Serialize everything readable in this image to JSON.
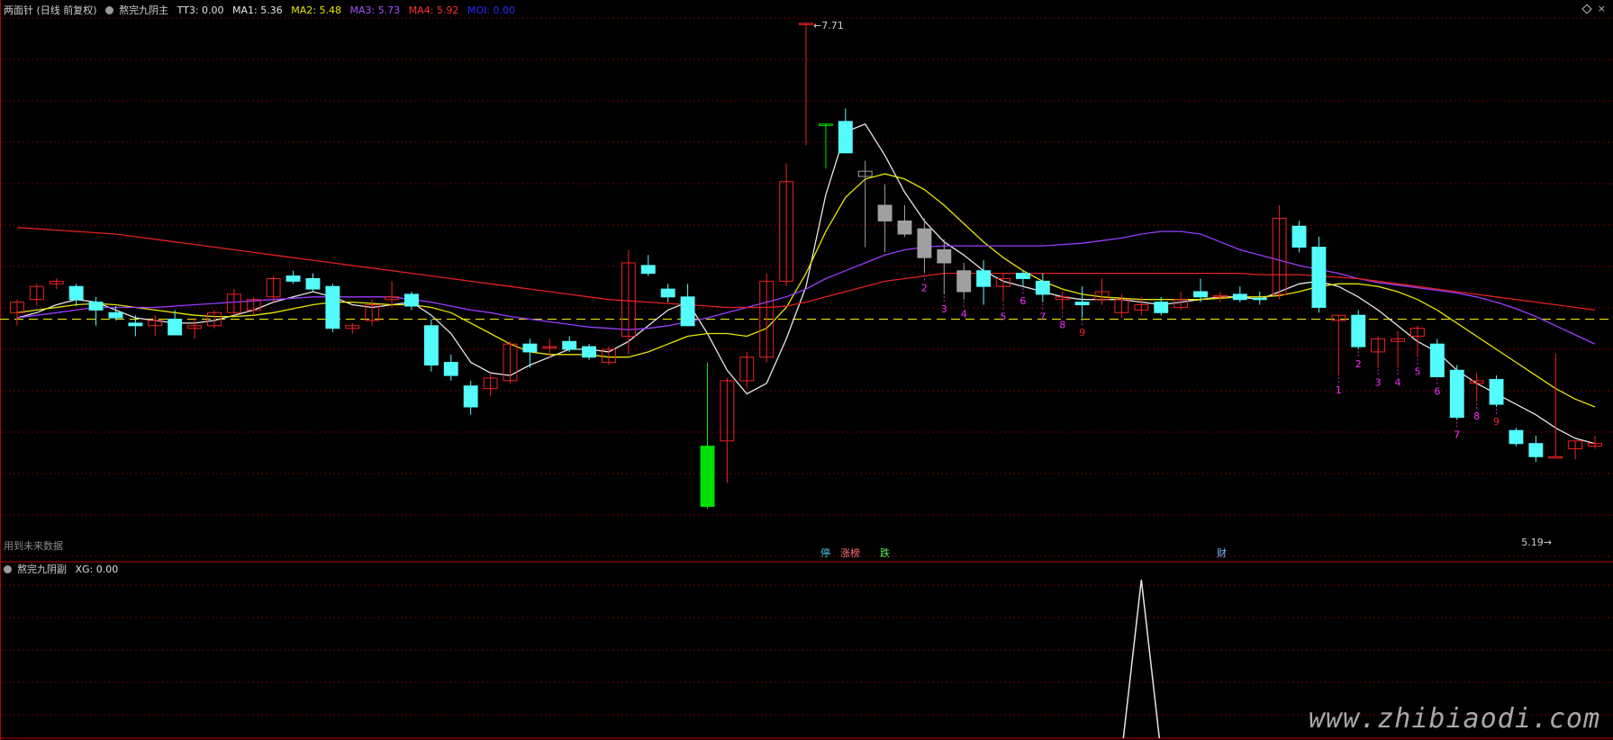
{
  "main_header": {
    "title": "两面针 (日线 前复权)",
    "indicator": "熬完九阴主",
    "tt3": "TT3: 0.00",
    "ma1": "MA1: 5.36",
    "ma2": "MA2: 5.48",
    "ma3": "MA3: 5.73",
    "ma4": "MA4: 5.92",
    "mo": "MOI: 0.00"
  },
  "sub_header": {
    "indicator": "熬完九阴副",
    "xg": "XG: 0.00"
  },
  "notes": {
    "future_data": "用到未来数据",
    "high_label": "7.71",
    "low_label": "5.19"
  },
  "tags": [
    {
      "text": "停",
      "color": "#44c6e6"
    },
    {
      "text": "涨榜",
      "color": "#ff7070"
    },
    {
      "text": "跌",
      "color": "#55ee55"
    },
    {
      "text": "财",
      "color": "#7fb6ff"
    }
  ],
  "watermark": "www.zhibiaodi.com",
  "colors": {
    "up": "#ee2222",
    "down": "#54fcfc",
    "limit_down": "#00e000",
    "ma1": "#e6e6e6",
    "ma2": "#e6e600",
    "ma3": "#9a3cff",
    "ma4": "#e02020",
    "grid": "#6a0000"
  },
  "icons": [
    "indicator-toggle-icon",
    "collapse-diamond-icon",
    "close-x-icon"
  ],
  "chart_data": {
    "type": "candlestick",
    "series_fields": [
      "open",
      "high",
      "low",
      "close"
    ],
    "candles": [
      [
        5.5,
        5.6,
        5.4,
        5.58
      ],
      [
        5.6,
        5.72,
        5.55,
        5.7
      ],
      [
        5.72,
        5.76,
        5.68,
        5.74
      ],
      [
        5.7,
        5.72,
        5.55,
        5.6
      ],
      [
        5.58,
        5.62,
        5.4,
        5.52
      ],
      [
        5.5,
        5.55,
        5.44,
        5.46
      ],
      [
        5.42,
        5.48,
        5.32,
        5.4
      ],
      [
        5.4,
        5.48,
        5.32,
        5.44
      ],
      [
        5.45,
        5.52,
        5.4,
        5.33
      ],
      [
        5.38,
        5.46,
        5.3,
        5.4
      ],
      [
        5.4,
        5.52,
        5.38,
        5.5
      ],
      [
        5.5,
        5.68,
        5.48,
        5.64
      ],
      [
        5.52,
        5.62,
        5.48,
        5.6
      ],
      [
        5.62,
        5.78,
        5.58,
        5.76
      ],
      [
        5.78,
        5.82,
        5.72,
        5.74
      ],
      [
        5.76,
        5.8,
        5.66,
        5.68
      ],
      [
        5.7,
        5.72,
        5.35,
        5.38
      ],
      [
        5.38,
        5.42,
        5.34,
        5.4
      ],
      [
        5.44,
        5.6,
        5.4,
        5.56
      ],
      [
        5.6,
        5.74,
        5.54,
        5.62
      ],
      [
        5.64,
        5.66,
        5.52,
        5.55
      ],
      [
        5.4,
        5.45,
        5.05,
        5.1
      ],
      [
        5.12,
        5.18,
        4.98,
        5.02
      ],
      [
        4.94,
        4.98,
        4.72,
        4.78
      ],
      [
        4.92,
        5.04,
        4.86,
        5.0
      ],
      [
        4.98,
        5.28,
        4.96,
        5.26
      ],
      [
        5.26,
        5.3,
        5.08,
        5.2
      ],
      [
        5.24,
        5.3,
        5.16,
        5.24
      ],
      [
        5.28,
        5.32,
        5.2,
        5.22
      ],
      [
        5.24,
        5.26,
        5.14,
        5.16
      ],
      [
        5.12,
        5.24,
        5.1,
        5.22
      ],
      [
        5.32,
        5.98,
        5.18,
        5.88
      ],
      [
        5.86,
        5.94,
        5.78,
        5.8
      ],
      [
        5.68,
        5.72,
        5.58,
        5.62
      ],
      [
        5.62,
        5.72,
        5.5,
        5.4
      ],
      [
        4.48,
        5.12,
        4.0,
        4.02
      ],
      [
        4.52,
        5.0,
        4.2,
        4.98
      ],
      [
        4.98,
        5.2,
        4.92,
        5.16
      ],
      [
        5.16,
        5.8,
        5.12,
        5.74
      ],
      [
        5.74,
        6.64,
        5.7,
        6.5
      ],
      [
        7.71,
        7.71,
        6.78,
        7.71
      ],
      [
        6.94,
        6.94,
        6.6,
        6.94
      ],
      [
        6.96,
        7.06,
        6.72,
        6.72
      ],
      [
        6.54,
        6.66,
        6.0,
        6.58
      ],
      [
        6.32,
        6.48,
        5.96,
        6.2
      ],
      [
        6.2,
        6.32,
        6.08,
        6.1
      ],
      [
        6.14,
        6.22,
        5.8,
        5.92
      ],
      [
        5.98,
        6.06,
        5.64,
        5.88
      ],
      [
        5.82,
        5.88,
        5.6,
        5.66
      ],
      [
        5.82,
        5.9,
        5.56,
        5.7
      ],
      [
        5.7,
        5.8,
        5.58,
        5.76
      ],
      [
        5.8,
        5.82,
        5.7,
        5.76
      ],
      [
        5.74,
        5.8,
        5.58,
        5.64
      ],
      [
        5.6,
        5.66,
        5.52,
        5.62
      ],
      [
        5.58,
        5.7,
        5.46,
        5.56
      ],
      [
        5.6,
        5.76,
        5.56,
        5.66
      ],
      [
        5.5,
        5.64,
        5.46,
        5.6
      ],
      [
        5.52,
        5.62,
        5.48,
        5.56
      ],
      [
        5.58,
        5.62,
        5.48,
        5.5
      ],
      [
        5.54,
        5.66,
        5.52,
        5.6
      ],
      [
        5.66,
        5.76,
        5.58,
        5.62
      ],
      [
        5.62,
        5.66,
        5.58,
        5.63
      ],
      [
        5.64,
        5.7,
        5.58,
        5.6
      ],
      [
        5.61,
        5.66,
        5.56,
        5.6
      ],
      [
        5.64,
        6.32,
        5.6,
        6.22
      ],
      [
        6.16,
        6.2,
        5.96,
        6.0
      ],
      [
        6.0,
        6.08,
        5.5,
        5.54
      ],
      [
        5.44,
        5.48,
        5.02,
        5.48
      ],
      [
        5.48,
        5.52,
        5.22,
        5.24
      ],
      [
        5.2,
        5.32,
        5.08,
        5.3
      ],
      [
        5.28,
        5.36,
        5.08,
        5.3
      ],
      [
        5.32,
        5.4,
        5.16,
        5.38
      ],
      [
        5.26,
        5.3,
        5.02,
        5.01
      ],
      [
        5.06,
        5.1,
        4.68,
        4.7
      ],
      [
        4.96,
        5.04,
        4.82,
        4.98
      ],
      [
        4.99,
        5.02,
        4.78,
        4.8
      ],
      [
        4.6,
        4.62,
        4.48,
        4.5
      ],
      [
        4.5,
        4.56,
        4.36,
        4.4
      ],
      [
        4.4,
        4.4,
        5.19,
        4.4
      ],
      [
        4.46,
        4.52,
        4.38,
        4.52
      ],
      [
        4.48,
        4.56,
        4.46,
        4.5
      ]
    ],
    "ma_lines": {
      "MA1": [
        5.46,
        5.5,
        5.56,
        5.6,
        5.58,
        5.52,
        5.46,
        5.44,
        5.42,
        5.42,
        5.44,
        5.48,
        5.52,
        5.58,
        5.62,
        5.66,
        5.62,
        5.56,
        5.54,
        5.56,
        5.58,
        5.48,
        5.34,
        5.12,
        5.04,
        5.02,
        5.1,
        5.16,
        5.22,
        5.22,
        5.2,
        5.28,
        5.4,
        5.52,
        5.58,
        5.34,
        5.06,
        4.88,
        4.96,
        5.3,
        5.7,
        6.4,
        6.88,
        6.94,
        6.7,
        6.42,
        6.2,
        6.04,
        5.94,
        5.82,
        5.74,
        5.7,
        5.66,
        5.62,
        5.6,
        5.6,
        5.6,
        5.58,
        5.56,
        5.58,
        5.6,
        5.62,
        5.62,
        5.6,
        5.66,
        5.72,
        5.74,
        5.7,
        5.62,
        5.52,
        5.4,
        5.28,
        5.2,
        5.06,
        4.96,
        4.88,
        4.8,
        4.72,
        4.62,
        4.54,
        4.5
      ],
      "MA2": [
        5.5,
        5.52,
        5.54,
        5.56,
        5.57,
        5.56,
        5.54,
        5.52,
        5.5,
        5.48,
        5.47,
        5.47,
        5.48,
        5.5,
        5.53,
        5.56,
        5.58,
        5.58,
        5.57,
        5.56,
        5.56,
        5.54,
        5.5,
        5.42,
        5.34,
        5.26,
        5.2,
        5.18,
        5.18,
        5.18,
        5.16,
        5.16,
        5.2,
        5.26,
        5.32,
        5.34,
        5.34,
        5.32,
        5.38,
        5.54,
        5.8,
        6.12,
        6.38,
        6.52,
        6.56,
        6.52,
        6.44,
        6.32,
        6.18,
        6.04,
        5.92,
        5.82,
        5.74,
        5.68,
        5.64,
        5.62,
        5.61,
        5.6,
        5.6,
        5.6,
        5.6,
        5.61,
        5.62,
        5.62,
        5.63,
        5.66,
        5.7,
        5.72,
        5.72,
        5.7,
        5.66,
        5.6,
        5.52,
        5.42,
        5.32,
        5.22,
        5.12,
        5.02,
        4.92,
        4.84,
        4.78
      ],
      "MA3": [
        5.46,
        5.48,
        5.5,
        5.52,
        5.54,
        5.54,
        5.54,
        5.54,
        5.55,
        5.56,
        5.57,
        5.58,
        5.59,
        5.6,
        5.61,
        5.62,
        5.62,
        5.62,
        5.62,
        5.62,
        5.6,
        5.58,
        5.55,
        5.52,
        5.5,
        5.47,
        5.45,
        5.43,
        5.41,
        5.39,
        5.38,
        5.37,
        5.38,
        5.4,
        5.43,
        5.46,
        5.5,
        5.54,
        5.58,
        5.62,
        5.68,
        5.76,
        5.82,
        5.88,
        5.94,
        5.98,
        6.0,
        6.01,
        6.01,
        6.01,
        6.01,
        6.01,
        6.01,
        6.02,
        6.03,
        6.05,
        6.07,
        6.1,
        6.12,
        6.12,
        6.1,
        6.04,
        5.98,
        5.94,
        5.9,
        5.86,
        5.83,
        5.8,
        5.76,
        5.73,
        5.71,
        5.69,
        5.67,
        5.65,
        5.62,
        5.58,
        5.53,
        5.47,
        5.4,
        5.33,
        5.26
      ],
      "MA4": [
        6.15,
        6.14,
        6.13,
        6.12,
        6.11,
        6.1,
        6.08,
        6.06,
        6.04,
        6.02,
        6.0,
        5.98,
        5.96,
        5.94,
        5.92,
        5.9,
        5.88,
        5.86,
        5.84,
        5.82,
        5.8,
        5.78,
        5.76,
        5.74,
        5.72,
        5.7,
        5.68,
        5.66,
        5.64,
        5.62,
        5.6,
        5.59,
        5.58,
        5.57,
        5.56,
        5.55,
        5.54,
        5.54,
        5.54,
        5.55,
        5.58,
        5.62,
        5.66,
        5.7,
        5.74,
        5.76,
        5.78,
        5.8,
        5.8,
        5.8,
        5.8,
        5.8,
        5.8,
        5.8,
        5.8,
        5.8,
        5.8,
        5.8,
        5.8,
        5.8,
        5.8,
        5.8,
        5.8,
        5.79,
        5.79,
        5.79,
        5.78,
        5.77,
        5.76,
        5.74,
        5.72,
        5.7,
        5.68,
        5.66,
        5.64,
        5.62,
        5.6,
        5.58,
        5.56,
        5.54,
        5.52
      ]
    },
    "baseline": 5.45,
    "signal_counts": [
      {
        "i": 46,
        "n": "2",
        "c": "#ff2bff"
      },
      {
        "i": 47,
        "n": "3",
        "c": "#ff2bff"
      },
      {
        "i": 48,
        "n": "4",
        "c": "#ff2bff"
      },
      {
        "i": 50,
        "n": "5",
        "c": "#ff2bff"
      },
      {
        "i": 51,
        "n": "6",
        "c": "#ff2bff"
      },
      {
        "i": 52,
        "n": "7",
        "c": "#ff2bff"
      },
      {
        "i": 53,
        "n": "8",
        "c": "#ff2bff"
      },
      {
        "i": 54,
        "n": "9",
        "c": "#ee2222"
      },
      {
        "i": 67,
        "n": "1",
        "c": "#ff2bff"
      },
      {
        "i": 68,
        "n": "2",
        "c": "#ff2bff"
      },
      {
        "i": 69,
        "n": "3",
        "c": "#ff2bff"
      },
      {
        "i": 70,
        "n": "4",
        "c": "#ff2bff"
      },
      {
        "i": 71,
        "n": "5",
        "c": "#ff2bff"
      },
      {
        "i": 72,
        "n": "6",
        "c": "#ff2bff"
      },
      {
        "i": 73,
        "n": "7",
        "c": "#ff2bff"
      },
      {
        "i": 74,
        "n": "8",
        "c": "#ff2bff"
      },
      {
        "i": 75,
        "n": "9",
        "c": "#ee2222"
      }
    ],
    "xg_signal": {
      "index": 57,
      "value": 1
    }
  }
}
